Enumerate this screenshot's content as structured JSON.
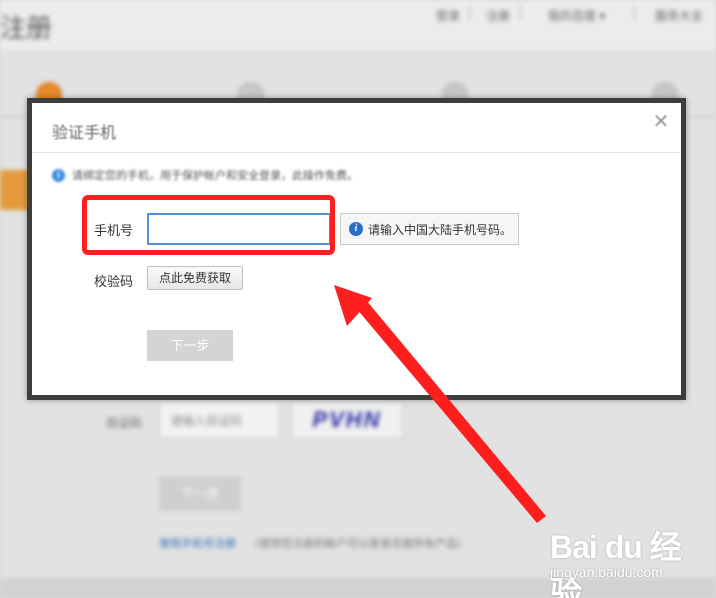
{
  "background": {
    "page_title": "注册",
    "nav": [
      "登录",
      "注册",
      "我的百度 ▾",
      "服务大全"
    ],
    "bg_form": {
      "captcha_label": "验证码",
      "captcha_placeholder": "请输入验证码",
      "captcha_image_text": "PVHN",
      "next_label": "下一步",
      "link_text": "使用手机号注册",
      "note_text": "（使用您注册的帐户可以登录百度所有产品）"
    }
  },
  "modal": {
    "title": "验证手机",
    "close_glyph": "✕",
    "notice_icon": "i",
    "notice_text": "请绑定您的手机，用于保护帐户和安全登录，此操作免费。",
    "phone_label": "手机号",
    "phone_value": "",
    "hint_icon": "i",
    "hint_text": "请输入中国大陆手机号码。",
    "code_label": "校验码",
    "code_button": "点此免费获取",
    "next_button": "下一步"
  },
  "annotation": {
    "highlight_color": "#ff1e1e",
    "arrow_color": "#ff1e1e"
  },
  "watermark": {
    "logo": "Bai du 经验",
    "site": "jingyan.baidu.com"
  }
}
